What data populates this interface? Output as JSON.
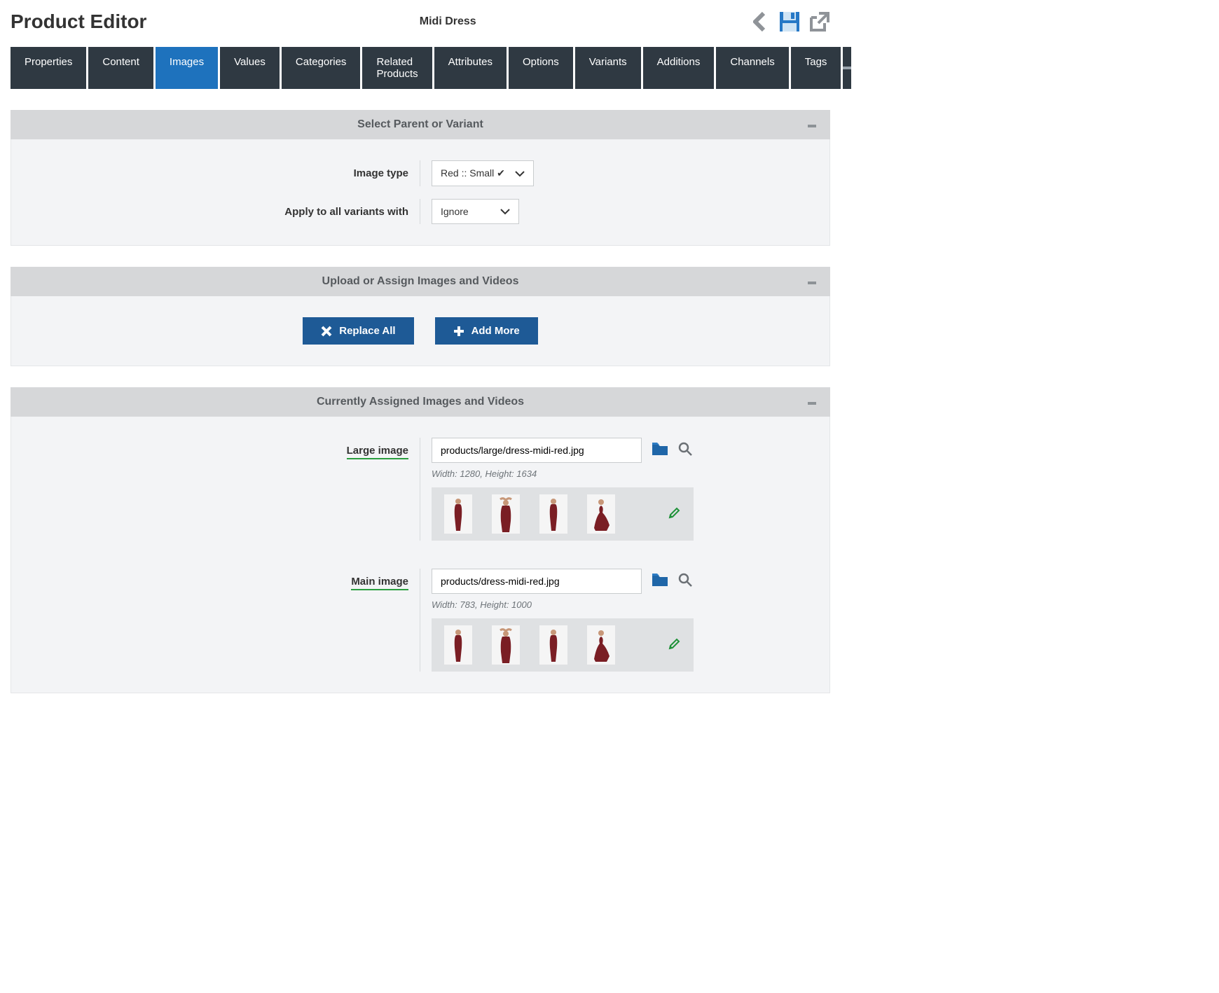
{
  "header": {
    "title": "Product Editor",
    "product_name": "Midi Dress"
  },
  "tabs": [
    {
      "label": "Properties"
    },
    {
      "label": "Content"
    },
    {
      "label": "Images"
    },
    {
      "label": "Values"
    },
    {
      "label": "Categories"
    },
    {
      "label": "Related Products"
    },
    {
      "label": "Attributes"
    },
    {
      "label": "Options"
    },
    {
      "label": "Variants"
    },
    {
      "label": "Additions"
    },
    {
      "label": "Channels"
    },
    {
      "label": "Tags"
    }
  ],
  "panel1": {
    "title": "Select Parent or Variant",
    "image_type_label": "Image type",
    "image_type_value": "Red :: Small ✔",
    "apply_label": "Apply to all variants with",
    "apply_value": "Ignore"
  },
  "panel2": {
    "title": "Upload or Assign Images and Videos",
    "replace_label": "Replace All",
    "add_label": "Add More"
  },
  "panel3": {
    "title": "Currently Assigned Images and Videos",
    "large": {
      "label": "Large image",
      "path": "products/large/dress-midi-red.jpg",
      "dims": "Width: 1280, Height: 1634"
    },
    "main": {
      "label": "Main image",
      "path": "products/dress-midi-red.jpg",
      "dims": "Width: 783, Height: 1000"
    }
  }
}
